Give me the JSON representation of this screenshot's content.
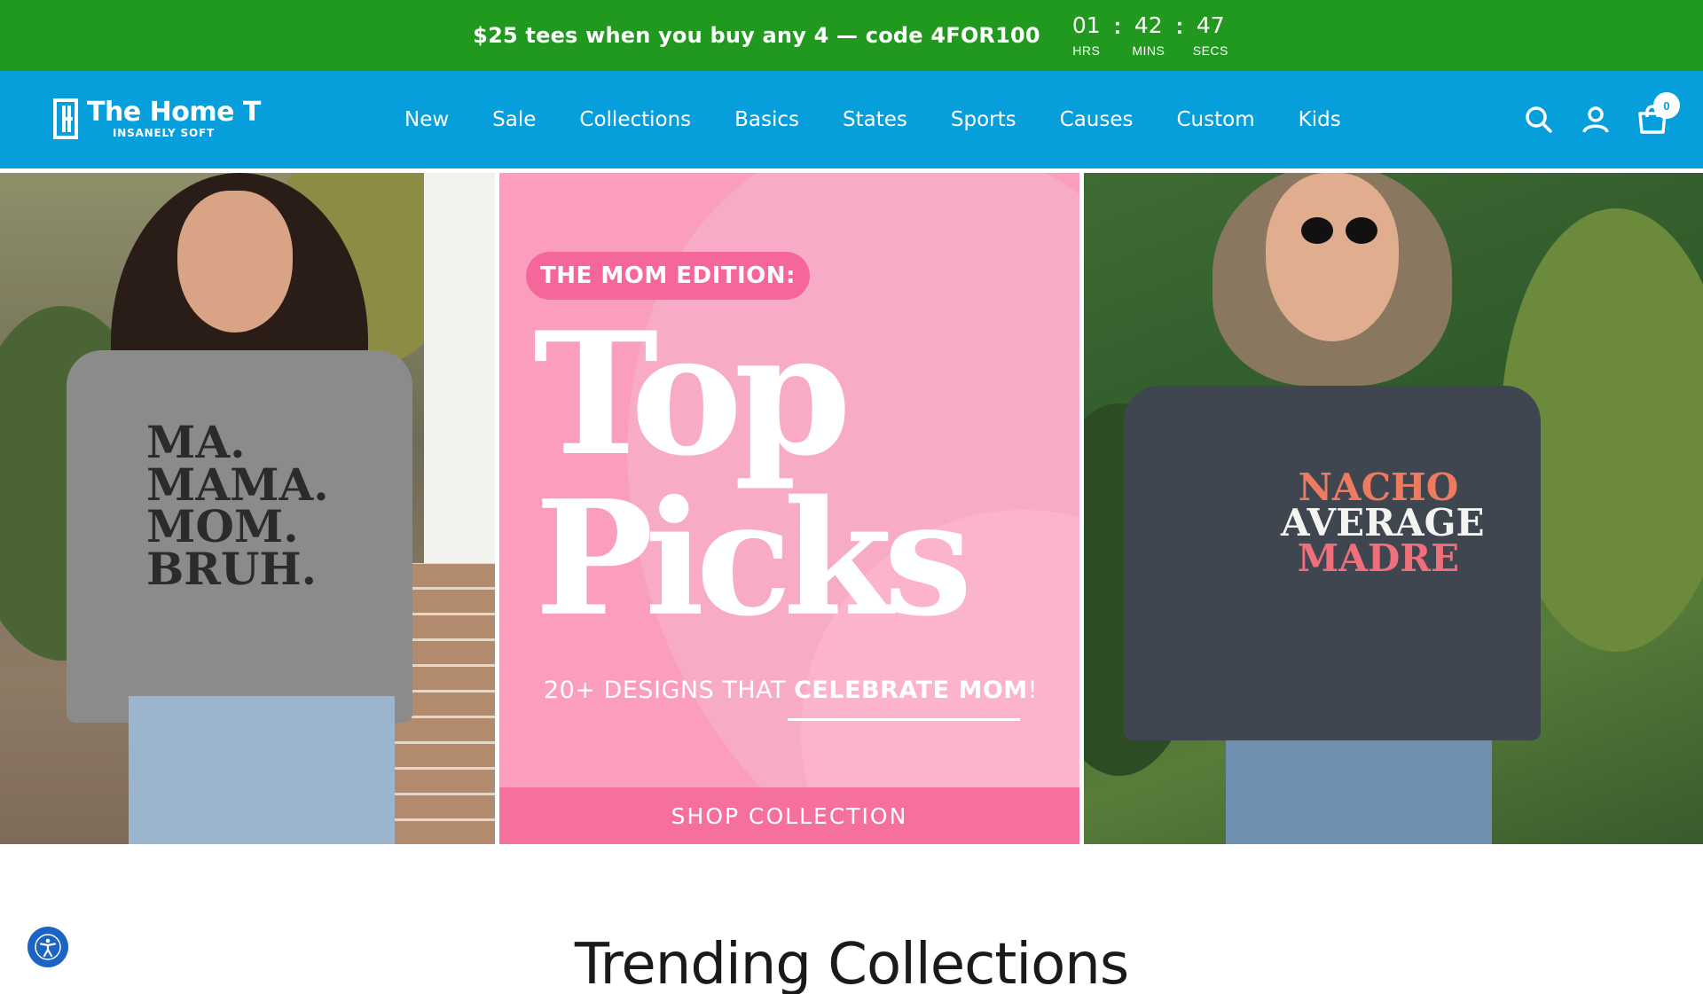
{
  "announcement": {
    "text": "$25 tees when you buy any 4 — code 4FOR100",
    "countdown": [
      {
        "value": "01",
        "label": "HRS"
      },
      {
        "value": "42",
        "label": "MINS"
      },
      {
        "value": "47",
        "label": "SECS"
      }
    ],
    "separator": ":",
    "bg_color": "#21991f"
  },
  "header": {
    "logo_name": "The Home T",
    "logo_tagline": "INSANELY SOFT",
    "nav": [
      "New",
      "Sale",
      "Collections",
      "Basics",
      "States",
      "Sports",
      "Causes",
      "Custom",
      "Kids"
    ],
    "icons": [
      "search-icon",
      "account-icon",
      "cart-icon"
    ],
    "cart_count": "0",
    "bg_color": "#069fdc"
  },
  "hero": {
    "left_shirt_lines": [
      "MA.",
      "MAMA.",
      "MOM.",
      "BRUH."
    ],
    "mid": {
      "pill": "THE MOM EDITION:",
      "title_1": "Top",
      "title_2": "Picks",
      "sub_plain": "20+ DESIGNS THAT ",
      "sub_bold": "CELEBRATE MOM",
      "sub_end": "!",
      "cta": "SHOP COLLECTION"
    },
    "right_shirt_lines": [
      "NACHO",
      "AVERAGE",
      "MADRE"
    ]
  },
  "section_title": "Trending Collections",
  "accessibility_icon": "accessibility-icon"
}
